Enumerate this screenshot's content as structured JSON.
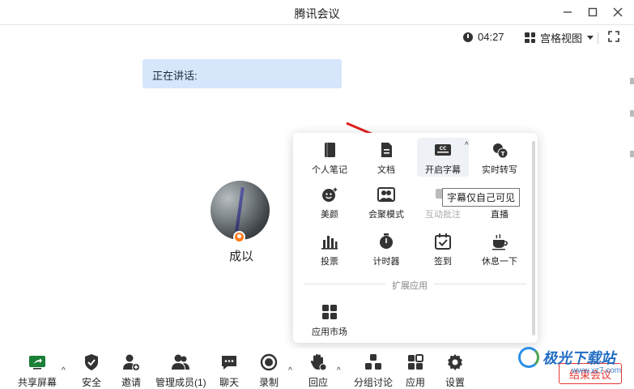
{
  "window": {
    "title": "腾讯会议",
    "controls": [
      "minimize-icon",
      "maximize-icon",
      "close-icon"
    ]
  },
  "subbar": {
    "timer": "04:27",
    "view_label": "宫格视图"
  },
  "speaking": {
    "label": "正在讲话:"
  },
  "participant": {
    "name": "成以"
  },
  "panel": {
    "tools": [
      {
        "label": "个人笔记",
        "icon": "notebook-icon"
      },
      {
        "label": "文档",
        "icon": "document-icon"
      },
      {
        "label": "开启字幕",
        "icon": "captions-icon"
      },
      {
        "label": "实时转写",
        "icon": "transcribe-icon"
      },
      {
        "label": "美颜",
        "icon": "beauty-icon"
      },
      {
        "label": "会聚模式",
        "icon": "together-mode-icon"
      },
      {
        "label": "互动批注",
        "icon": "annotate-icon"
      },
      {
        "label": "直播",
        "icon": "live-icon"
      },
      {
        "label": "投票",
        "icon": "vote-icon"
      },
      {
        "label": "计时器",
        "icon": "timer-icon"
      },
      {
        "label": "签到",
        "icon": "checkin-icon"
      },
      {
        "label": "休息一下",
        "icon": "coffee-icon"
      }
    ],
    "section_label": "扩展应用",
    "apps": [
      {
        "label": "应用市场",
        "icon": "app-market-icon"
      }
    ],
    "tooltip": "字幕仅自己可见"
  },
  "bottombar": {
    "items": [
      {
        "label": "共享屏幕",
        "icon": "share-screen-icon"
      },
      {
        "label": "安全",
        "icon": "shield-icon"
      },
      {
        "label": "邀请",
        "icon": "invite-icon"
      },
      {
        "label": "管理成员(1)",
        "icon": "members-icon"
      },
      {
        "label": "聊天",
        "icon": "chat-icon"
      },
      {
        "label": "录制",
        "icon": "record-icon"
      },
      {
        "label": "回应",
        "icon": "reaction-icon"
      },
      {
        "label": "分组讨论",
        "icon": "breakout-icon"
      },
      {
        "label": "应用",
        "icon": "apps-icon"
      },
      {
        "label": "设置",
        "icon": "gear-icon"
      }
    ],
    "end_label": "结束会议"
  },
  "watermark": {
    "text": "极光下载站",
    "sub": "www.xz7.com"
  },
  "colors": {
    "accent_blue": "#d6e6fb",
    "arrow_red": "#e02020",
    "end_red": "#e53935",
    "host_orange": "#ff7a1a"
  }
}
